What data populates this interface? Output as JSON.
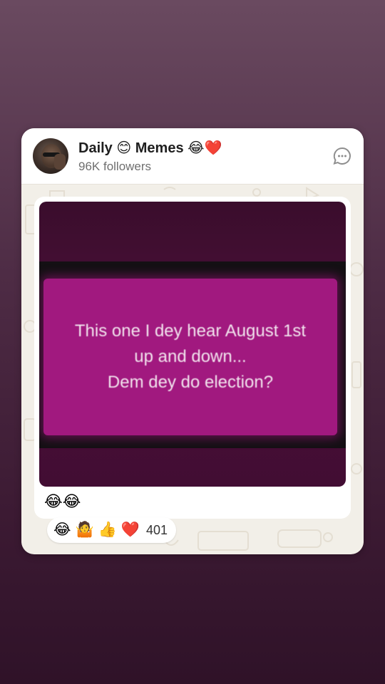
{
  "channel": {
    "name": "Daily 😊 Memes 😂❤️",
    "followers": "96K followers"
  },
  "post": {
    "image_text": "This one I dey hear August 1st\nup and down...\nDem dey do election?",
    "caption": "😂😂"
  },
  "reactions": {
    "emojis": [
      "😂",
      "🤷",
      "👍",
      "❤️"
    ],
    "count": "401"
  },
  "icons": {
    "chat": "chat-bubble-icon"
  },
  "colors": {
    "background_top": "#6a4a60",
    "background_bottom": "#2f1228",
    "meme_panel": "#a1197f"
  }
}
